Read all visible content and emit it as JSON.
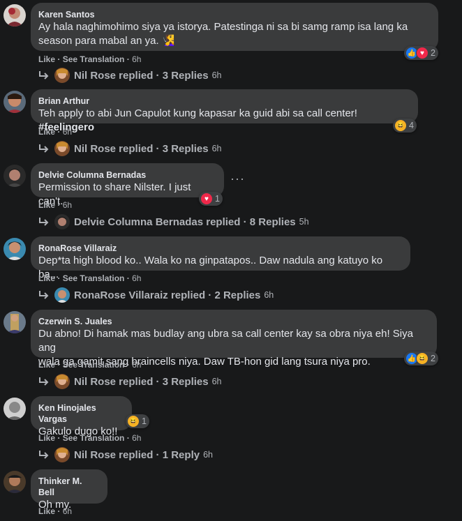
{
  "comments": [
    {
      "name": "Karen Santos",
      "text_lines": [
        "Ay hala naghimohimo siya ya istorya. Patestinga ni sa bi samg ramp isa lang ka",
        "season para mabal an ya. 🧏‍♀️"
      ],
      "meta": {
        "like": "Like",
        "sep": " · ",
        "see_translation": "See Translation",
        "time": "6h"
      },
      "reactions": {
        "icons": [
          "like",
          "love"
        ],
        "count": "2"
      },
      "replies": {
        "replier": "Nil Rose replied",
        "count": "3 Replies",
        "time": "6h"
      }
    },
    {
      "name": "Brian Arthur",
      "text": "Teh apply to abi Jun Capulot kung kapasar ka guid abi sa call center! ",
      "hashtag": "#feelingero",
      "meta": {
        "like": "Like",
        "sep": " · ",
        "time": "6h"
      },
      "reactions": {
        "icons": [
          "haha"
        ],
        "count": "4"
      },
      "replies": {
        "replier": "Nil Rose replied",
        "count": "3 Replies",
        "time": "6h"
      }
    },
    {
      "name": "Delvie Columna Bernadas",
      "text": "Permission to share Nilster. I just can't.",
      "meta": {
        "like": "Like",
        "sep": " · ",
        "time": "6h"
      },
      "reactions": {
        "icons": [
          "love"
        ],
        "count": "1"
      },
      "more": "···",
      "replies": {
        "replier": "Delvie Columna Bernadas replied",
        "count": "8 Replies",
        "time": "5h"
      }
    },
    {
      "name": "RonaRose Villaraiz",
      "text": "Dep*ta high blood ko.. Wala ko na ginpatapos.. Daw nadula ang katuyo ko ba...",
      "meta": {
        "like": "Like",
        "sep": " · ",
        "see_translation": "See Translation",
        "time": "6h"
      },
      "replies": {
        "replier": "RonaRose Villaraiz replied",
        "count": "2 Replies",
        "time": "6h"
      }
    },
    {
      "name": "Czerwin S. Juales",
      "text_lines": [
        "Du abno! Di hamak mas budlay ang ubra sa call center kay sa obra niya eh! Siya ang",
        "wala ga gamit sang braincells niya. Daw TB-hon gid lang tsura niya pro."
      ],
      "meta": {
        "like": "Like",
        "sep": " · ",
        "see_translation": "See Translation",
        "time": "6h"
      },
      "reactions": {
        "icons": [
          "like",
          "haha"
        ],
        "count": "2"
      },
      "replies": {
        "replier": "Nil Rose replied",
        "count": "3 Replies",
        "time": "6h"
      }
    },
    {
      "name": "Ken Hinojales Vargas",
      "text": "Gakulo dugo ko!!",
      "meta": {
        "like": "Like",
        "sep": " · ",
        "see_translation": "See Translation",
        "time": "6h"
      },
      "reactions": {
        "icons": [
          "haha"
        ],
        "count": "1"
      },
      "replies": {
        "replier": "Nil Rose replied",
        "count": "1 Reply",
        "time": "6h"
      }
    },
    {
      "name": "Thinker M. Bell",
      "text": "Oh my.",
      "meta": {
        "like": "Like",
        "sep": " · ",
        "time": "6h"
      }
    }
  ],
  "colors": {
    "background": "#18191a",
    "bubble": "#3a3b3c",
    "text": "#e4e6eb",
    "secondary": "#b0b3b8",
    "like": "#1877f2",
    "love": "#f0284a",
    "haha": "#f7b125"
  },
  "icons": {
    "reply": "reply-arrow-icon",
    "like": "like-reaction-icon",
    "love": "love-reaction-icon",
    "haha": "haha-reaction-icon"
  }
}
